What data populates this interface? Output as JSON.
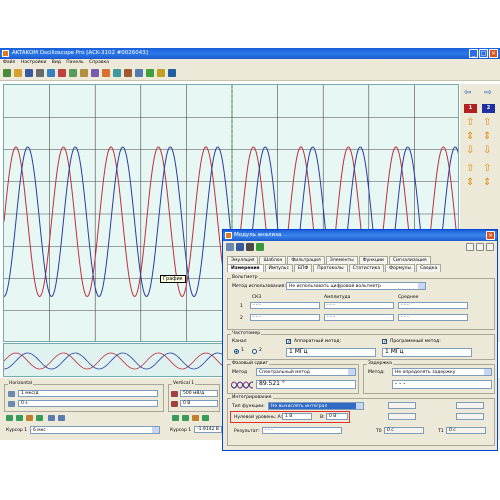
{
  "window": {
    "title": "AKTAKOM Oscilloscope Pro [ACK-3102 #0026043]"
  },
  "menu": [
    "Файл",
    "Настройки",
    "Вид",
    "Панель",
    "Справка"
  ],
  "scope": {
    "tooltip": "График"
  },
  "right_panel": {
    "ch1": "1",
    "ch2": "2"
  },
  "horizontal": {
    "title": "Horizontal",
    "scale": "1 мкс/д",
    "offset": "0 s"
  },
  "vertical": {
    "title": "Vertical 1",
    "scale": "500 мВ/д",
    "offset": "0 В"
  },
  "cursors": {
    "left_label": "Курсор 1",
    "left_value": "6 мкс",
    "right_label": "Курсор 1",
    "right_value": "-1.9142 В"
  },
  "dialog": {
    "title": "Модуль анализа",
    "tabs_row1": [
      "Эмуляция",
      "Шаблон",
      "Фильтрация",
      "Элементы",
      "Функции",
      "Сигнализация"
    ],
    "tabs_row2": [
      "Измерения",
      "Импульс",
      "БПФ",
      "Протоколы",
      "Статистика",
      "Формулы",
      "Сводка"
    ],
    "voltmeter": {
      "title": "Вольтметр",
      "method_label": "Метод использования:",
      "method_value": "Не использовать цифровой вольтметр",
      "col1": "СКЗ",
      "col2": "Амплитуда",
      "col3": "Среднее",
      "row1": "1",
      "row2": "2",
      "v11": "- - -",
      "v12": "- - -",
      "v13": "- - -",
      "v21": "- - -",
      "v22": "- - -",
      "v23": "- - -"
    },
    "freq": {
      "title": "Частотомер",
      "channel_label": "Канал",
      "radio1": "1",
      "radio2": "2",
      "hw_label": "Аппаратный метод:",
      "sw_label": "Программный метод:",
      "hw_value": "1 МГц",
      "sw_value": "1 МГц"
    },
    "phase": {
      "title": "Фазовый сдвиг",
      "method_label": "Метод",
      "method_value": "Спектральный метод",
      "value": "89.521 °"
    },
    "delay": {
      "title": "Задержка",
      "method_label": "Метод:",
      "method_value": "Не определять задержку",
      "value": "- - -"
    },
    "integr": {
      "title": "Интегрирование",
      "type_label": "Тип функции:",
      "type_value": "Не вычислять интеграл",
      "zero_label": "Нулевой уровень: A:",
      "zero_a": "1 В",
      "b_label": "B:",
      "zero_b": "0 В",
      "result_label": "Результат:",
      "result_value": "- - -",
      "t0_label": "T0",
      "t0_value": "0 с",
      "t1_label": "T1",
      "t1_value": "0 с"
    }
  },
  "colors": {
    "trace1": "#c03040",
    "trace2": "#2c3e9e",
    "grid": "#4a4a4a",
    "scope_bg": "#e6f7f4",
    "cursor": "#3a7a3a"
  }
}
